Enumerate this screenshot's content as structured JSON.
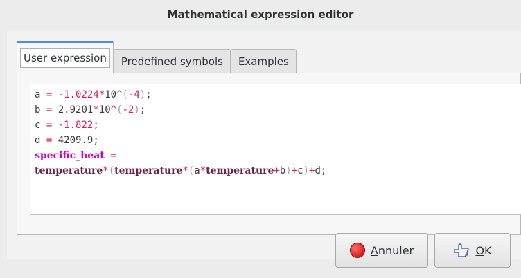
{
  "window": {
    "title": "Mathematical expression editor"
  },
  "tabs": [
    {
      "label": "User expression",
      "active": true
    },
    {
      "label": "Predefined symbols",
      "active": false
    },
    {
      "label": "Examples",
      "active": false
    }
  ],
  "editor": {
    "line1": {
      "lhs": "a",
      "eq": "=",
      "num1": "-1.0224",
      "mul": "*",
      "num2": "10",
      "pow": "^",
      "open": "(",
      "exp": "-4",
      "close": ")",
      "end": ";"
    },
    "line2": {
      "lhs": "b",
      "eq": "=",
      "num1": "2.9201",
      "mul": "*",
      "num2": "10",
      "pow": "^",
      "open": "(",
      "exp": "-2",
      "close": ")",
      "end": ";"
    },
    "line3": {
      "lhs": "c",
      "eq": "=",
      "value": "-1.822",
      "end": ";"
    },
    "line4": {
      "lhs": "d",
      "eq": "=",
      "value": "4209.9",
      "end": ";"
    },
    "line5": {
      "lhs": "specific_heat",
      "eq": "="
    },
    "line6": {
      "t1": "temperature",
      "m1": "*",
      "o1": "(",
      "t2": "temperature",
      "m2": "*",
      "o2": "(",
      "a": "a",
      "m3": "*",
      "t3": "temperature",
      "p1": "+",
      "b": "b",
      "c1": ")",
      "p2": "+",
      "c": "c",
      "c2": ")",
      "p3": "+",
      "d": "d",
      "end": ";"
    }
  },
  "buttons": {
    "cancel": {
      "label_underlined": "A",
      "label_rest": "nnuler",
      "icon": "stop-icon"
    },
    "ok": {
      "label_underlined": "O",
      "label_rest": "K",
      "icon": "ok-hand-icon"
    }
  },
  "colors": {
    "tab_accent": "#4a90d9",
    "operator": "#e0185a",
    "variable": "#c800c8"
  }
}
